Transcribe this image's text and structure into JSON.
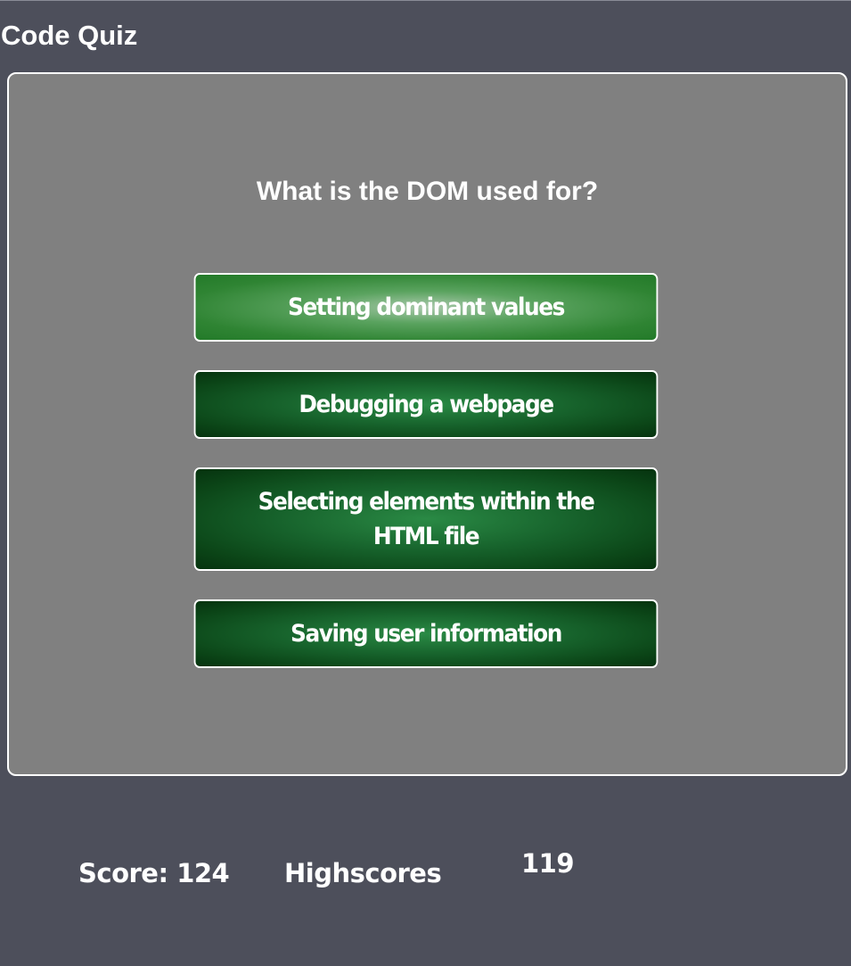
{
  "app": {
    "title": "Code Quiz"
  },
  "quiz": {
    "question": "What is the DOM used for?",
    "answers": [
      {
        "label": "Setting dominant values",
        "state": "highlighted"
      },
      {
        "label": "Debugging a webpage",
        "state": "normal"
      },
      {
        "label": "Selecting elements within the HTML file",
        "state": "normal"
      },
      {
        "label": "Saving user information",
        "state": "normal"
      }
    ]
  },
  "footer": {
    "score_label": "Score:",
    "score_value": "124",
    "highscores_label": "Highscores",
    "highscore_value": "119"
  },
  "colors": {
    "page_background": "#4d4f5b",
    "card_background": "#808080",
    "answer_highlight": "#5aa35f",
    "answer_normal": "#17632c",
    "text": "#ffffff"
  }
}
